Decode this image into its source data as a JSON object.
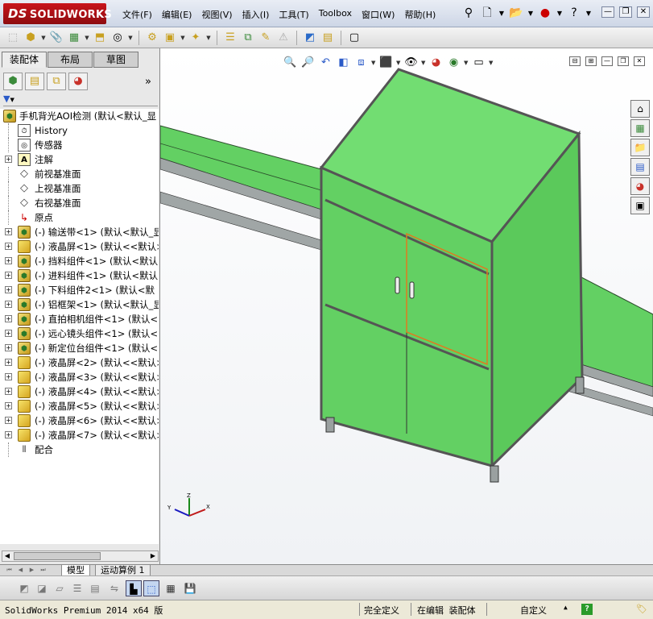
{
  "app": {
    "brand": "SOLIDWORKS",
    "brand_prefix": "DS"
  },
  "menu": [
    "文件(F)",
    "编辑(E)",
    "视图(V)",
    "插入(I)",
    "工具(T)",
    "Toolbox",
    "窗口(W)",
    "帮助(H)"
  ],
  "panel_tabs": [
    "装配体",
    "布局",
    "草图"
  ],
  "tree": {
    "root": "手机背光AOI检测  (默认<默认_显",
    "items": [
      {
        "label": "History",
        "icon": "history-icon",
        "expand": false
      },
      {
        "label": "传感器",
        "icon": "sensor-icon",
        "expand": false
      },
      {
        "label": "注解",
        "icon": "annotation-icon",
        "expand": true
      },
      {
        "label": "前视基准面",
        "icon": "plane-icon",
        "expand": false
      },
      {
        "label": "上视基准面",
        "icon": "plane-icon",
        "expand": false
      },
      {
        "label": "右视基准面",
        "icon": "plane-icon",
        "expand": false
      },
      {
        "label": "原点",
        "icon": "origin-icon",
        "expand": false
      },
      {
        "label": "(-) 输送带<1> (默认<默认_显",
        "icon": "assembly-icon",
        "expand": true
      },
      {
        "label": "(-) 液晶屏<1> (默认<<默认>",
        "icon": "part-icon",
        "expand": true
      },
      {
        "label": "(-) 挡料组件<1> (默认<默认",
        "icon": "assembly-icon",
        "expand": true
      },
      {
        "label": "(-) 进料组件<1> (默认<默认",
        "icon": "assembly-icon",
        "expand": true
      },
      {
        "label": "(-) 下料组件2<1> (默认<默",
        "icon": "assembly-icon",
        "expand": true
      },
      {
        "label": "(-) 铝框架<1> (默认<默认_显",
        "icon": "assembly-icon",
        "expand": true
      },
      {
        "label": "(-) 直拍相机组件<1> (默认<",
        "icon": "assembly-icon",
        "expand": true
      },
      {
        "label": "(-) 远心镜头组件<1> (默认<",
        "icon": "assembly-icon",
        "expand": true
      },
      {
        "label": "(-) 新定位台组件<1> (默认<",
        "icon": "assembly-icon",
        "expand": true
      },
      {
        "label": "(-) 液晶屏<2> (默认<<默认>",
        "icon": "part-icon",
        "expand": true
      },
      {
        "label": "(-) 液晶屏<3> (默认<<默认>",
        "icon": "part-icon",
        "expand": true
      },
      {
        "label": "(-) 液晶屏<4> (默认<<默认>",
        "icon": "part-icon",
        "expand": true
      },
      {
        "label": "(-) 液晶屏<5> (默认<<默认>",
        "icon": "part-icon",
        "expand": true
      },
      {
        "label": "(-) 液晶屏<6> (默认<<默认>",
        "icon": "part-icon",
        "expand": true
      },
      {
        "label": "(-) 液晶屏<7> (默认<<默认>",
        "icon": "part-icon",
        "expand": true
      },
      {
        "label": "配合",
        "icon": "mates-icon",
        "expand": false
      }
    ]
  },
  "bottom_tabs": [
    "模型",
    "运动算例 1"
  ],
  "status": {
    "product": "SolidWorks Premium 2014 x64 版",
    "definition": "完全定义",
    "mode": "在编辑 装配体",
    "units": "自定义"
  },
  "colors": {
    "machine_green": "#5fcf5f",
    "frame_grey": "#9aa0a0",
    "brand_red": "#b8121a",
    "selection_orange": "#e07a20"
  }
}
